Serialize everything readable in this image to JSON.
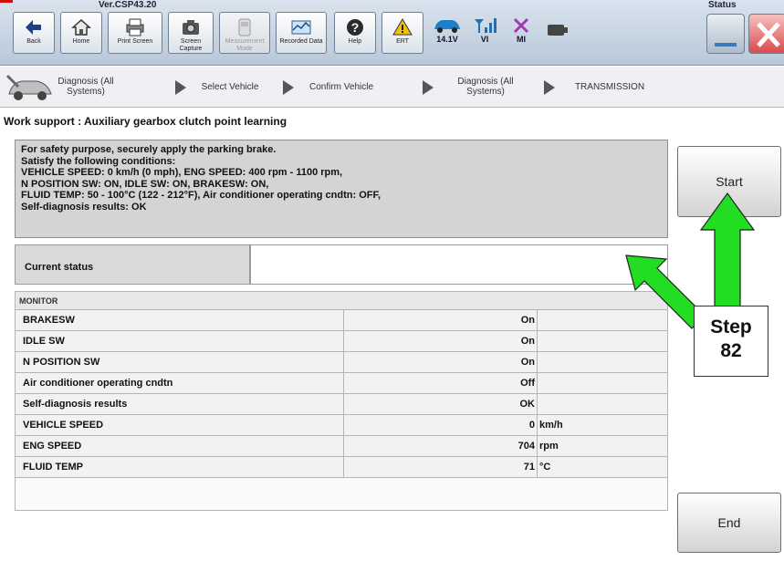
{
  "app": {
    "version": "Ver.CSP43.20",
    "status_label": "Status"
  },
  "toolbar": {
    "buttons": [
      {
        "label": "Back",
        "icon": "back-arrow-icon",
        "enabled": true
      },
      {
        "label": "Home",
        "icon": "home-icon",
        "enabled": true
      },
      {
        "label": "Print Screen",
        "icon": "printer-icon",
        "enabled": true
      },
      {
        "label": "Screen Capture",
        "icon": "camera-icon",
        "enabled": true
      },
      {
        "label": "Measurement Mode",
        "icon": "meter-icon",
        "enabled": false
      },
      {
        "label": "Recorded Data",
        "icon": "recorded-data-icon",
        "enabled": true
      },
      {
        "label": "Help",
        "icon": "help-icon",
        "enabled": true
      },
      {
        "label": "ERT",
        "icon": "warning-icon",
        "enabled": true
      }
    ],
    "status": {
      "battery": "14.1V",
      "vi": "VI",
      "mi": "MI"
    }
  },
  "breadcrumb": {
    "items": [
      "Diagnosis (All Systems)",
      "Select Vehicle",
      "Confirm Vehicle",
      "Diagnosis (All Systems)",
      "TRANSMISSION"
    ]
  },
  "work_support": {
    "title": "Work support : Auxiliary gearbox clutch point learning",
    "instructions": [
      "For safety purpose, securely apply the parking brake.",
      "Satisfy the following conditions:",
      "VEHICLE SPEED: 0 km/h (0 mph), ENG SPEED: 400 rpm - 1100 rpm,",
      "N POSITION SW: ON, IDLE SW: ON, BRAKESW: ON,",
      "FLUID TEMP: 50 - 100°C (122 - 212°F), Air conditioner operating cndtn: OFF,",
      "Self-diagnosis results: OK"
    ],
    "current_status_label": "Current status",
    "current_status_value": ""
  },
  "monitor": {
    "header": "MONITOR",
    "rows": [
      {
        "name": "BRAKESW",
        "value": "On",
        "unit": ""
      },
      {
        "name": "IDLE SW",
        "value": "On",
        "unit": ""
      },
      {
        "name": "N POSITION SW",
        "value": "On",
        "unit": ""
      },
      {
        "name": "Air conditioner operating cndtn",
        "value": "Off",
        "unit": ""
      },
      {
        "name": "Self-diagnosis results",
        "value": "OK",
        "unit": ""
      },
      {
        "name": "VEHICLE SPEED",
        "value": "0",
        "unit": "km/h"
      },
      {
        "name": "ENG SPEED",
        "value": "704",
        "unit": "rpm"
      },
      {
        "name": "FLUID TEMP",
        "value": "71",
        "unit": "°C"
      }
    ]
  },
  "buttons": {
    "start": "Start",
    "end": "End"
  },
  "annotation": {
    "step_word": "Step",
    "step_number": "82",
    "arrow_color": "#22dd22"
  }
}
